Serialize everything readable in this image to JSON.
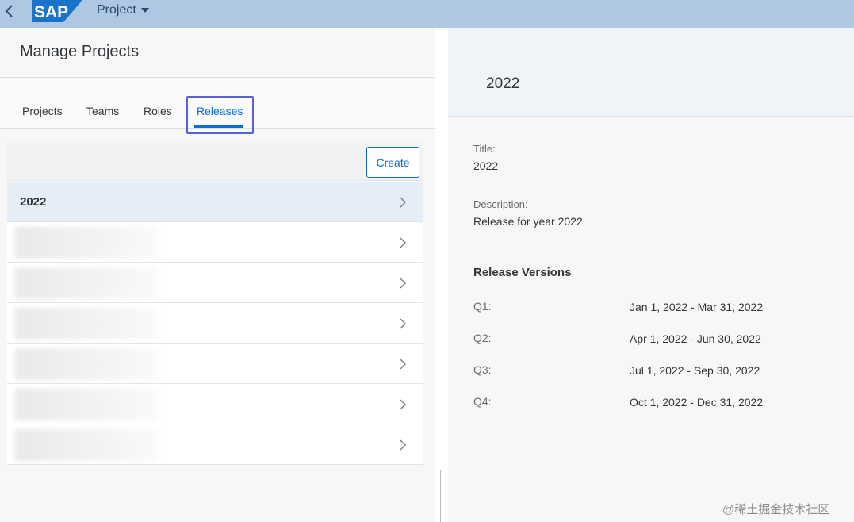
{
  "shell": {
    "logo_text": "SAP",
    "app_title": "Project"
  },
  "master": {
    "title": "Manage Projects",
    "tabs": [
      {
        "label": "Projects"
      },
      {
        "label": "Teams"
      },
      {
        "label": "Roles"
      },
      {
        "label": "Releases"
      }
    ],
    "active_tab": "Releases",
    "create_label": "Create",
    "list": [
      {
        "label": "2022",
        "selected": true
      },
      {
        "label": "",
        "blurred": true
      },
      {
        "label": "",
        "blurred": true
      },
      {
        "label": "",
        "blurred": true
      },
      {
        "label": "",
        "blurred": true
      },
      {
        "label": "",
        "blurred": true
      },
      {
        "label": "",
        "blurred": true
      }
    ]
  },
  "detail": {
    "header_title": "2022",
    "title_label": "Title:",
    "title_value": "2022",
    "description_label": "Description:",
    "description_value": "Release for year 2022",
    "versions_heading": "Release Versions",
    "versions": [
      {
        "quarter": "Q1:",
        "range": "Jan 1, 2022 - Mar 31, 2022"
      },
      {
        "quarter": "Q2:",
        "range": "Apr 1, 2022 - Jun 30, 2022"
      },
      {
        "quarter": "Q3:",
        "range": "Jul 1, 2022 - Sep 30, 2022"
      },
      {
        "quarter": "Q4:",
        "range": "Oct 1, 2022 - Dec 31, 2022"
      }
    ]
  },
  "watermark": "@稀土掘金技术社区",
  "colors": {
    "shell_bg": "#aec7e3",
    "accent": "#0a6ed1",
    "tab_highlight": "#5762d9",
    "sap_logo": "#1a73c8"
  }
}
